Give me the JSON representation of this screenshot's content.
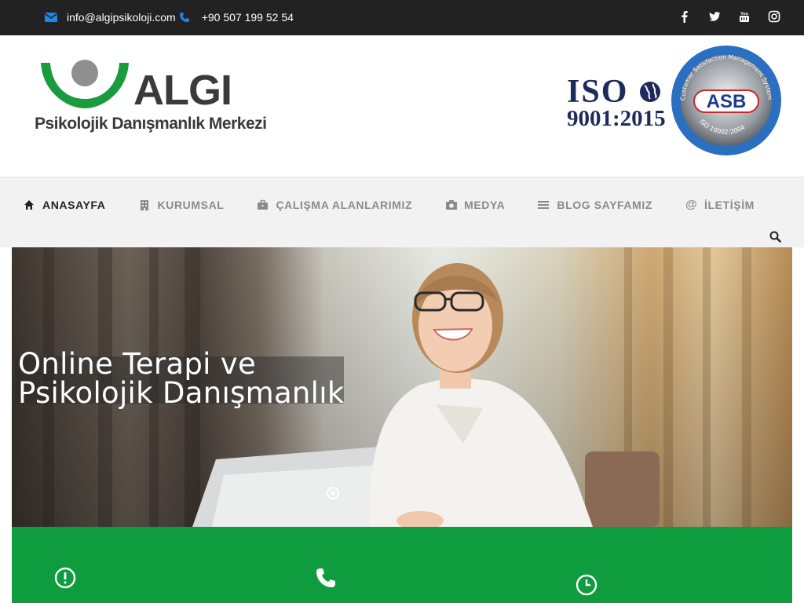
{
  "topbar": {
    "email": "info@algipsikoloji.com",
    "phone": "+90 507 199 52 54",
    "social": [
      "facebook-icon",
      "twitter-icon",
      "youtube-icon",
      "instagram-icon"
    ]
  },
  "header": {
    "logo_brand": "ALGI",
    "logo_subtitle": "Psikolojik Danışmanlık Merkezi",
    "iso_line1": "ISO",
    "iso_line2": "9001:2015",
    "seal_text": "ASB",
    "seal_ring_top": "Customer Satisfaction Management System",
    "seal_ring_bottom": "ISO 10002:2004"
  },
  "nav": {
    "items": [
      {
        "label": "ANASAYFA",
        "icon": "home-icon",
        "active": true
      },
      {
        "label": "KURUMSAL",
        "icon": "building-icon",
        "active": false
      },
      {
        "label": "ÇALIŞMA ALANLARIMIZ",
        "icon": "briefcase-icon",
        "active": false
      },
      {
        "label": "MEDYA",
        "icon": "camera-icon",
        "active": false
      },
      {
        "label": "BLOG SAYFAMIZ",
        "icon": "list-icon",
        "active": false
      },
      {
        "label": "İLETİŞİM",
        "icon": "at-icon",
        "active": false
      }
    ]
  },
  "hero": {
    "caption_line1": "Online Terapi ve",
    "caption_line2": "Psikolojik Danışmanlık"
  },
  "colors": {
    "topbar_bg": "#222222",
    "accent_blue": "#1e88e5",
    "brand_green": "#0e9c3f",
    "nav_bg": "#f2f2f2"
  }
}
